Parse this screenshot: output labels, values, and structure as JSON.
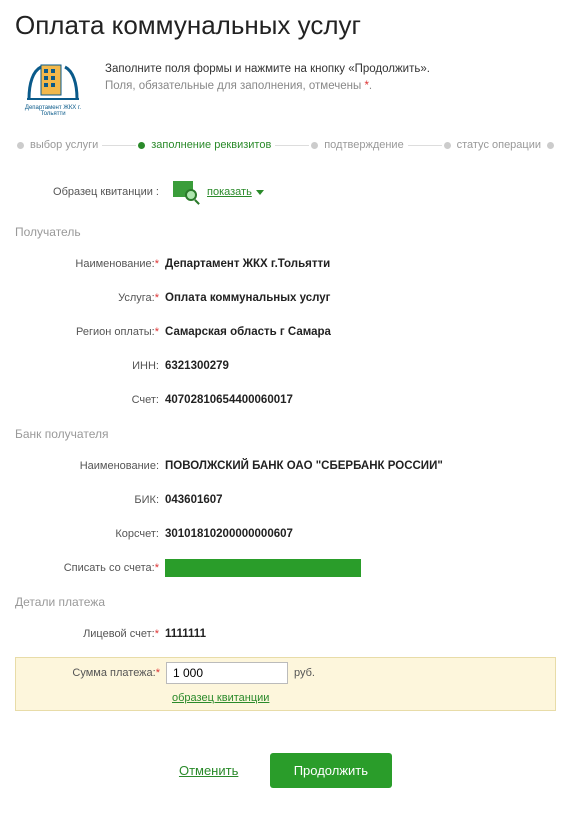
{
  "title": "Оплата коммунальных услуг",
  "intro": {
    "line1": "Заполните поля формы и нажмите на кнопку «Продолжить».",
    "line2_a": "Поля, обязательные для заполнения, отмечены ",
    "line2_b": "."
  },
  "steps": {
    "s1": "выбор услуги",
    "s2": "заполнение реквизитов",
    "s3": "подтверждение",
    "s4": "статус операции"
  },
  "receipt": {
    "label": "Образец квитанции :",
    "action": "показать"
  },
  "sections": {
    "recipient": "Получатель",
    "bank": "Банк получателя",
    "details": "Детали платежа"
  },
  "fields": {
    "recipient_name": {
      "label": "Наименование:",
      "value": "Департамент ЖКХ г.Тольятти"
    },
    "service": {
      "label": "Услуга:",
      "value": "Оплата коммунальных услуг"
    },
    "region": {
      "label": "Регион оплаты:",
      "value": "Самарская область г Самара"
    },
    "inn": {
      "label": "ИНН:",
      "value": "6321300279"
    },
    "account": {
      "label": "Счет:",
      "value": "40702810654400060017"
    },
    "bank_name": {
      "label": "Наименование:",
      "value": "ПОВОЛЖСКИЙ БАНК ОАО \"СБЕРБАНК РОССИИ\""
    },
    "bik": {
      "label": "БИК:",
      "value": "043601607"
    },
    "corr": {
      "label": "Корсчет:",
      "value": "30101810200000000607"
    },
    "from_account": {
      "label": "Списать со счета:",
      "value": ""
    },
    "personal_acc": {
      "label": "Лицевой счет:",
      "value": "1111111"
    },
    "amount": {
      "label": "Сумма платежа:",
      "value": "1 000",
      "currency": "руб."
    }
  },
  "links": {
    "receipt_sample": "образец квитанции"
  },
  "actions": {
    "cancel": "Отменить",
    "continue": "Продолжить"
  },
  "logo_caption": "Департамент ЖКХ г. Тольятти"
}
